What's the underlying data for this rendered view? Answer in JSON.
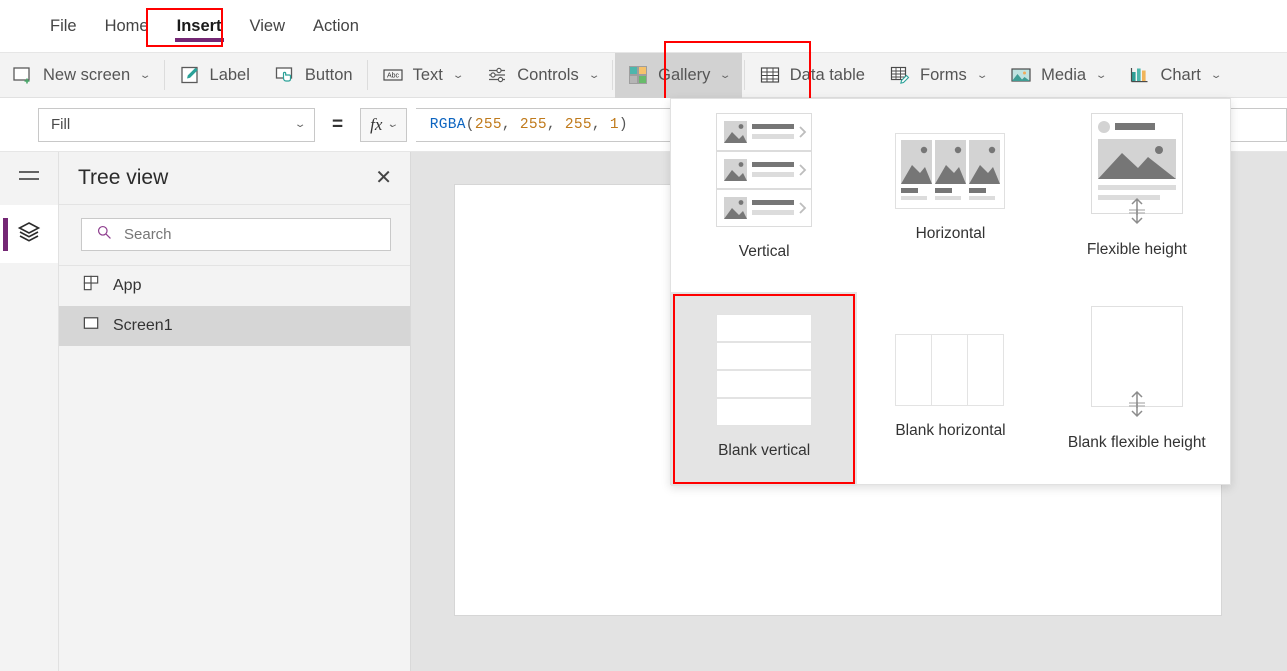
{
  "menubar": {
    "items": [
      {
        "label": "File",
        "active": false
      },
      {
        "label": "Home",
        "active": false
      },
      {
        "label": "Insert",
        "active": true
      },
      {
        "label": "View",
        "active": false
      },
      {
        "label": "Action",
        "active": false
      }
    ],
    "active_underline_color": "#742774",
    "highlight_color": "#ff0000"
  },
  "ribbon": {
    "items": [
      {
        "label": "New screen",
        "icon": "new-screen-icon",
        "has_chevron": true,
        "active": false
      },
      {
        "label": "Label",
        "icon": "label-icon",
        "has_chevron": false,
        "active": false
      },
      {
        "label": "Button",
        "icon": "button-icon",
        "has_chevron": false,
        "active": false
      },
      {
        "label": "Text",
        "icon": "text-abc-icon",
        "has_chevron": true,
        "active": false
      },
      {
        "label": "Controls",
        "icon": "controls-sliders-icon",
        "has_chevron": true,
        "active": false
      },
      {
        "label": "Gallery",
        "icon": "gallery-grid-icon",
        "has_chevron": true,
        "active": true
      },
      {
        "label": "Data table",
        "icon": "data-table-icon",
        "has_chevron": false,
        "active": false
      },
      {
        "label": "Forms",
        "icon": "forms-icon",
        "has_chevron": true,
        "active": false
      },
      {
        "label": "Media",
        "icon": "media-image-icon",
        "has_chevron": true,
        "active": false
      },
      {
        "label": "Chart",
        "icon": "chart-bars-icon",
        "has_chevron": true,
        "active": false
      }
    ]
  },
  "formula_bar": {
    "property_value": "Fill",
    "equals": "=",
    "fx_label": "fx",
    "formula_tokens": [
      {
        "text": "RGBA",
        "type": "fn"
      },
      {
        "text": "(",
        "type": "punc"
      },
      {
        "text": "255",
        "type": "num"
      },
      {
        "text": ", ",
        "type": "punc"
      },
      {
        "text": "255",
        "type": "num"
      },
      {
        "text": ", ",
        "type": "punc"
      },
      {
        "text": "255",
        "type": "num"
      },
      {
        "text": ", ",
        "type": "punc"
      },
      {
        "text": "1",
        "type": "num"
      },
      {
        "text": ")",
        "type": "punc"
      }
    ],
    "formula_text": "RGBA(255, 255, 255, 1)"
  },
  "rail": {
    "burger_icon": "hamburger-menu-icon",
    "items": [
      {
        "icon": "layers-tree-view-icon",
        "selected": true
      }
    ],
    "accent_color": "#742774"
  },
  "tree_panel": {
    "title": "Tree view",
    "close_label": "✕",
    "search": {
      "placeholder": "Search",
      "icon": "search-icon",
      "value": ""
    },
    "rows": [
      {
        "label": "App",
        "icon": "app-icon",
        "selected": false
      },
      {
        "label": "Screen1",
        "icon": "screen-icon",
        "selected": true
      }
    ]
  },
  "gallery_flyout": {
    "options": [
      {
        "label": "Vertical",
        "art": "vertical-gallery-art",
        "selected": false
      },
      {
        "label": "Horizontal",
        "art": "horizontal-gallery-art",
        "selected": false
      },
      {
        "label": "Flexible height",
        "art": "flexible-height-gallery-art",
        "selected": false
      },
      {
        "label": "Blank vertical",
        "art": "blank-vertical-gallery-art",
        "selected": true
      },
      {
        "label": "Blank horizontal",
        "art": "blank-horizontal-gallery-art",
        "selected": false
      },
      {
        "label": "Blank flexible height",
        "art": "blank-flexible-height-gallery-art",
        "selected": false
      }
    ]
  },
  "canvas": {
    "screen_name": "Screen1",
    "screen_fill": "#ffffff",
    "background": "#e3e3e3"
  }
}
